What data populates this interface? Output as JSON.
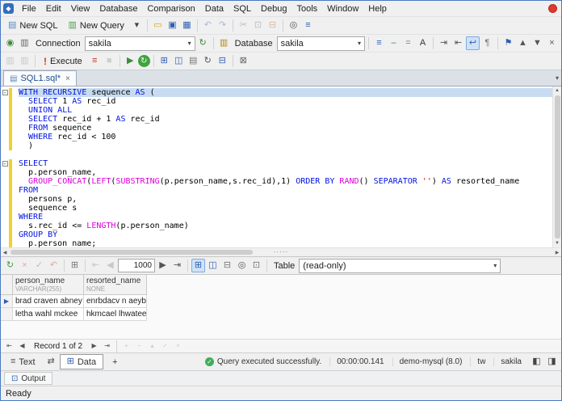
{
  "icons": {
    "app": "◆",
    "caret_down": "▾",
    "close": "×",
    "sql_file": "▤",
    "scroll_up": "▲",
    "scroll_down": "▼",
    "scroll_left": "◀",
    "scroll_right": "▶",
    "splitter_dots": "·····",
    "check": "✓",
    "row_arrow": "▶",
    "fold_collapse": "-",
    "text_tab": "≡",
    "swap": "⇄",
    "data_tab": "⊞",
    "plus": "+",
    "dock_left": "◧",
    "dock_right": "◨",
    "output": "⊡"
  },
  "menu": {
    "items": [
      "File",
      "Edit",
      "View",
      "Database",
      "Comparison",
      "Data",
      "SQL",
      "Debug",
      "Tools",
      "Window",
      "Help"
    ]
  },
  "toolbars": {
    "t1": [
      {
        "t": "btn",
        "n": "new-sql-button",
        "g": "▤",
        "gc": "#5b87c5",
        "label": "New SQL"
      },
      {
        "t": "btn",
        "n": "new-query-button",
        "g": "▥",
        "gc": "#4d9e4d",
        "label": "New Query"
      },
      {
        "n": "new-dropdown-caret",
        "g": "▾",
        "gc": "#444"
      },
      {
        "t": "sep"
      },
      {
        "n": "open-file-icon",
        "g": "▭",
        "gc": "#d8a200"
      },
      {
        "n": "save-icon",
        "g": "▣",
        "gc": "#2f5fb0"
      },
      {
        "n": "save-all-icon",
        "g": "▦",
        "gc": "#2f5fb0"
      },
      {
        "t": "sep"
      },
      {
        "n": "undo-icon",
        "g": "↶",
        "gc": "#2f5fb0",
        "dis": true
      },
      {
        "n": "redo-icon",
        "g": "↷",
        "gc": "#2f5fb0",
        "dis": true
      },
      {
        "t": "sep"
      },
      {
        "n": "cut-icon",
        "g": "✂",
        "gc": "#666",
        "dis": true
      },
      {
        "n": "copy-icon",
        "g": "⊡",
        "gc": "#666",
        "dis": true
      },
      {
        "n": "paste-icon",
        "g": "⊟",
        "gc": "#b2622d",
        "dis": true
      },
      {
        "t": "sep"
      },
      {
        "n": "find-icon",
        "g": "◎",
        "gc": "#555"
      },
      {
        "n": "options-icon",
        "g": "≡",
        "gc": "#2f5fb0"
      }
    ],
    "t2_left": [
      {
        "n": "new-connection-icon",
        "g": "◉",
        "gc": "#3d8a3d"
      },
      {
        "n": "connections-manager-icon",
        "g": "▥",
        "gc": "#666"
      }
    ],
    "connection_label": "Connection",
    "connection_value": "sakila",
    "database_label": "Database",
    "database_value": "sakila",
    "t2_right": [
      {
        "n": "format-sql-icon",
        "g": "≡",
        "gc": "#2f5fb0"
      },
      {
        "n": "comment-lines-icon",
        "g": "–",
        "gc": "#3d8a3d"
      },
      {
        "n": "uncomment-lines-icon",
        "g": "=",
        "gc": "#777"
      },
      {
        "n": "uppercase-icon",
        "g": "A",
        "gc": "#333"
      },
      {
        "t": "sep"
      },
      {
        "n": "indent-icon",
        "g": "⇥",
        "gc": "#555"
      },
      {
        "n": "outdent-icon",
        "g": "⇤",
        "gc": "#555"
      },
      {
        "n": "word-wrap-icon",
        "g": "↩",
        "gc": "#2f5fb0",
        "active": true
      },
      {
        "n": "whitespace-icon",
        "g": "¶",
        "gc": "#777"
      },
      {
        "t": "sep"
      },
      {
        "n": "bookmark-icon",
        "g": "⚑",
        "gc": "#2f5fb0"
      },
      {
        "n": "prev-bookmark-icon",
        "g": "▲",
        "gc": "#555"
      },
      {
        "n": "next-bookmark-icon",
        "g": "▼",
        "gc": "#555"
      },
      {
        "n": "clear-bookmarks-icon",
        "g": "×",
        "gc": "#555"
      }
    ],
    "t3_left": [
      {
        "n": "attach-database-icon",
        "g": "▥",
        "gc": "#888",
        "dis": true
      },
      {
        "n": "detach-database-icon",
        "g": "▥",
        "gc": "#888",
        "dis": true
      },
      {
        "t": "sep"
      }
    ],
    "execute_bang": "!",
    "execute_label": "Execute",
    "t3_right": [
      {
        "n": "execute-script-icon",
        "g": "≡",
        "gc": "#c0392b"
      },
      {
        "n": "stop-execution-icon",
        "g": "■",
        "gc": "#999",
        "dis": true
      },
      {
        "t": "sep"
      },
      {
        "n": "debug-icon",
        "g": "▶",
        "gc": "#3d8a3d"
      },
      {
        "n": "refresh-icon",
        "g": "↻",
        "gc": "#ffffff",
        "round": true
      },
      {
        "t": "sep"
      },
      {
        "n": "query-plan-icon",
        "g": "⊞",
        "gc": "#2f5fb0"
      },
      {
        "n": "visual-query-builder-icon",
        "g": "◫",
        "gc": "#2f5fb0"
      },
      {
        "n": "snippets-icon",
        "g": "▤",
        "gc": "#777"
      },
      {
        "n": "history-icon",
        "g": "↻",
        "gc": "#555"
      },
      {
        "n": "results-pane-icon",
        "g": "⊟",
        "gc": "#2f5fb0"
      },
      {
        "t": "sep"
      },
      {
        "n": "pin-results-icon",
        "g": "⊠",
        "gc": "#666"
      }
    ]
  },
  "tabs": {
    "active": "SQL1.sql*"
  },
  "editor": {
    "lines": [
      {
        "fold": true,
        "mark": true,
        "sel": true,
        "t": [
          [
            "k",
            "WITH RECURSIVE"
          ],
          [
            "p",
            " sequence "
          ],
          [
            "k",
            "AS"
          ],
          [
            "p",
            " ("
          ]
        ]
      },
      {
        "mark": true,
        "t": [
          [
            "p",
            "  "
          ],
          [
            "k",
            "SELECT"
          ],
          [
            "p",
            " 1 "
          ],
          [
            "k",
            "AS"
          ],
          [
            "p",
            " rec_id"
          ]
        ]
      },
      {
        "mark": true,
        "t": [
          [
            "p",
            "  "
          ],
          [
            "k",
            "UNION ALL"
          ]
        ]
      },
      {
        "mark": true,
        "t": [
          [
            "p",
            "  "
          ],
          [
            "k",
            "SELECT"
          ],
          [
            "p",
            " rec_id + 1 "
          ],
          [
            "k",
            "AS"
          ],
          [
            "p",
            " rec_id"
          ]
        ]
      },
      {
        "mark": true,
        "t": [
          [
            "p",
            "  "
          ],
          [
            "k",
            "FROM"
          ],
          [
            "p",
            " sequence"
          ]
        ]
      },
      {
        "mark": true,
        "t": [
          [
            "p",
            "  "
          ],
          [
            "k",
            "WHERE"
          ],
          [
            "p",
            " rec_id < 100"
          ]
        ]
      },
      {
        "mark": true,
        "t": [
          [
            "p",
            "  )"
          ]
        ]
      },
      {
        "t": []
      },
      {
        "fold": true,
        "mark": true,
        "t": [
          [
            "k",
            "SELECT"
          ]
        ]
      },
      {
        "mark": true,
        "t": [
          [
            "p",
            "  p.person_name,"
          ]
        ]
      },
      {
        "mark": true,
        "t": [
          [
            "p",
            "  "
          ],
          [
            "f",
            "GROUP_CONCAT"
          ],
          [
            "p",
            "("
          ],
          [
            "f",
            "LEFT"
          ],
          [
            "p",
            "("
          ],
          [
            "f",
            "SUBSTRING"
          ],
          [
            "p",
            "(p.person_name,s.rec_id),1) "
          ],
          [
            "k",
            "ORDER BY"
          ],
          [
            "p",
            " "
          ],
          [
            "f",
            "RAND"
          ],
          [
            "p",
            "() "
          ],
          [
            "k",
            "SEPARATOR"
          ],
          [
            "p",
            " "
          ],
          [
            "s",
            "''"
          ],
          [
            "p",
            ") "
          ],
          [
            "k",
            "AS"
          ],
          [
            "p",
            " resorted_name"
          ]
        ]
      },
      {
        "mark": true,
        "t": [
          [
            "k",
            "FROM"
          ]
        ]
      },
      {
        "mark": true,
        "t": [
          [
            "p",
            "  persons p,"
          ]
        ]
      },
      {
        "mark": true,
        "t": [
          [
            "p",
            "  sequence s"
          ]
        ]
      },
      {
        "mark": true,
        "t": [
          [
            "k",
            "WHERE"
          ]
        ]
      },
      {
        "mark": true,
        "t": [
          [
            "p",
            "  s.rec_id <= "
          ],
          [
            "f",
            "LENGTH"
          ],
          [
            "p",
            "(p.person_name)"
          ]
        ]
      },
      {
        "mark": true,
        "t": [
          [
            "k",
            "GROUP BY"
          ]
        ]
      },
      {
        "mark": true,
        "t": [
          [
            "p",
            "  p.person_name;"
          ]
        ]
      }
    ]
  },
  "grid_toolbar": {
    "left": [
      {
        "n": "refresh-data-icon",
        "g": "↻",
        "gc": "#3d9e3d"
      },
      {
        "n": "cancel-refresh-icon",
        "g": "×",
        "gc": "#c0392b",
        "dis": true
      },
      {
        "n": "apply-changes-icon",
        "g": "✓",
        "gc": "#3d8a3d",
        "dis": true
      },
      {
        "n": "revert-changes-icon",
        "g": "↶",
        "gc": "#c0392b",
        "dis": true
      },
      {
        "t": "sep"
      },
      {
        "n": "import-data-icon",
        "g": "⊞",
        "gc": "#777"
      },
      {
        "t": "sep"
      },
      {
        "n": "first-page-icon",
        "g": "⇤",
        "gc": "#888",
        "dis": true
      },
      {
        "n": "prev-page-icon",
        "g": "◀",
        "gc": "#888",
        "dis": true
      }
    ],
    "page_value": "1000",
    "right": [
      {
        "n": "next-page-icon",
        "g": "▶",
        "gc": "#555"
      },
      {
        "n": "last-page-icon",
        "g": "⇥",
        "gc": "#555"
      },
      {
        "t": "sep"
      },
      {
        "n": "grid-view-icon",
        "g": "⊞",
        "gc": "#2f5fb0",
        "active": true
      },
      {
        "n": "card-view-icon",
        "g": "◫",
        "gc": "#2f5fb0"
      },
      {
        "n": "aggregates-icon",
        "g": "⊟",
        "gc": "#777"
      },
      {
        "n": "search-data-icon",
        "g": "◎",
        "gc": "#555"
      },
      {
        "n": "export-data-icon",
        "g": "⊡",
        "gc": "#777"
      },
      {
        "t": "sep"
      }
    ],
    "table_label": "Table",
    "table_value": "(read-only)"
  },
  "grid": {
    "columns": [
      {
        "name": "person_name",
        "type": "VARCHAR(255)"
      },
      {
        "name": "resorted_name",
        "type": "NONE"
      }
    ],
    "rows": [
      {
        "cells": [
          "brad craven abney",
          "enrbdacv n aeybra"
        ]
      },
      {
        "cells": [
          "letha wahl mckee",
          "hkmcael lhwatee"
        ]
      }
    ],
    "current_row": 0
  },
  "record_nav": {
    "left": [
      {
        "n": "first-record-icon",
        "g": "⇤",
        "gc": "#555"
      },
      {
        "n": "prev-record-icon",
        "g": "◀",
        "gc": "#555"
      }
    ],
    "label": "Record 1 of 2",
    "right": [
      {
        "n": "next-record-icon",
        "g": "▶",
        "gc": "#555"
      },
      {
        "n": "last-record-icon",
        "g": "⇥",
        "gc": "#555"
      },
      {
        "t": "sep"
      },
      {
        "n": "insert-record-icon",
        "g": "+",
        "gc": "#888",
        "dis": true
      },
      {
        "n": "delete-record-icon",
        "g": "−",
        "gc": "#888",
        "dis": true
      },
      {
        "n": "edit-record-icon",
        "g": "▴",
        "gc": "#888",
        "dis": true
      },
      {
        "n": "post-edit-icon",
        "g": "✓",
        "gc": "#888",
        "dis": true
      },
      {
        "n": "cancel-edit-icon",
        "g": "×",
        "gc": "#888",
        "dis": true
      }
    ]
  },
  "bottom_tabs": {
    "text": "Text",
    "data": "Data",
    "plus": "+"
  },
  "status": {
    "success": "Query executed successfully.",
    "time": "00:00:00.141",
    "server": "demo-mysql (8.0)",
    "user": "tw",
    "database": "sakila"
  },
  "output": {
    "label": "Output"
  },
  "statusbar": {
    "ready": "Ready"
  }
}
